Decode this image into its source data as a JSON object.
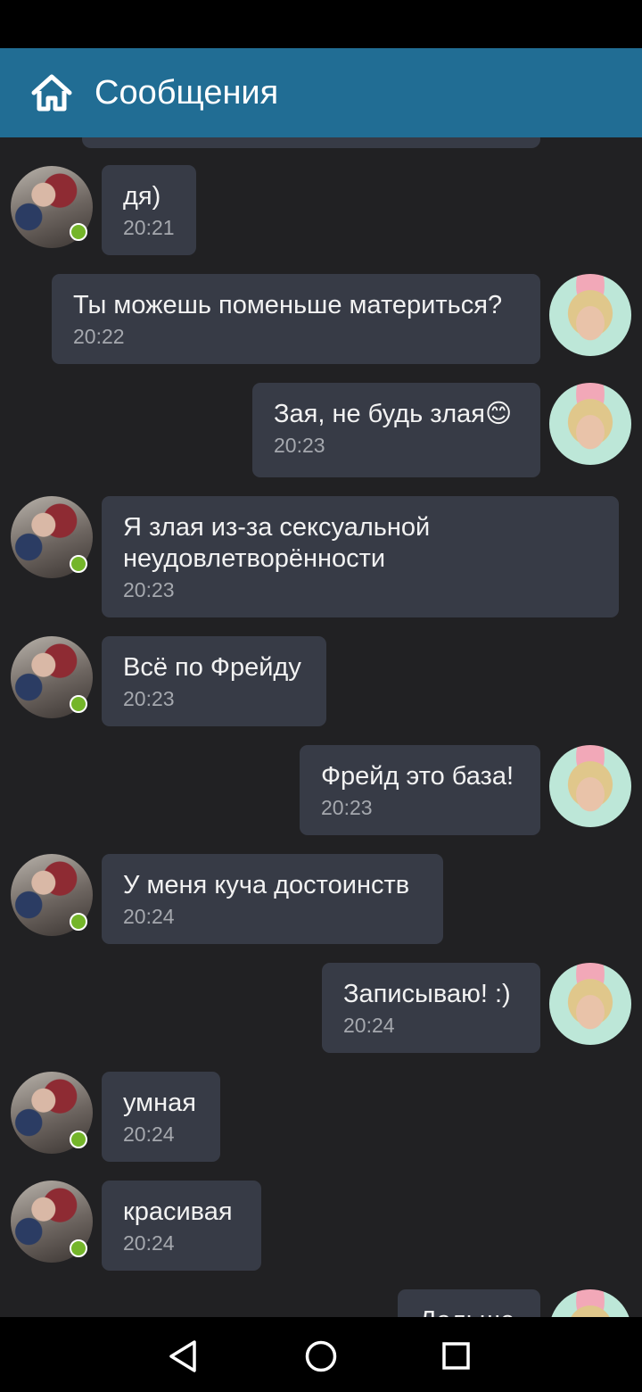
{
  "header": {
    "title": "Сообщения",
    "home_icon": "home-icon"
  },
  "colors": {
    "header": "#216d94",
    "background": "#212123",
    "bubble": "#373b46",
    "online": "#74b52a"
  },
  "messages": [
    {
      "sender": "other",
      "text": "дя)",
      "time": "20:21",
      "online": true
    },
    {
      "sender": "me",
      "text": "Ты можешь поменьше материться?",
      "time": "20:22"
    },
    {
      "sender": "me",
      "text": "Зая, не будь злая😊",
      "time": "20:23"
    },
    {
      "sender": "other",
      "text": "Я злая из-за сексуальной неудовлетворённости",
      "time": "20:23",
      "online": true
    },
    {
      "sender": "other",
      "text": "Всё по Фрейду",
      "time": "20:23",
      "online": true
    },
    {
      "sender": "me",
      "text": "Фрейд это база!",
      "time": "20:23"
    },
    {
      "sender": "other",
      "text": "У меня куча достоинств",
      "time": "20:24",
      "online": true
    },
    {
      "sender": "me",
      "text": "Записываю! :)",
      "time": "20:24"
    },
    {
      "sender": "other",
      "text": "умная",
      "time": "20:24",
      "online": true
    },
    {
      "sender": "other",
      "text": "красивая",
      "time": "20:24",
      "online": true
    },
    {
      "sender": "me",
      "text": "Дальше",
      "time": ""
    }
  ],
  "nav": {
    "back_icon": "back-triangle-icon",
    "home_icon": "home-circle-icon",
    "recents_icon": "recents-square-icon"
  }
}
